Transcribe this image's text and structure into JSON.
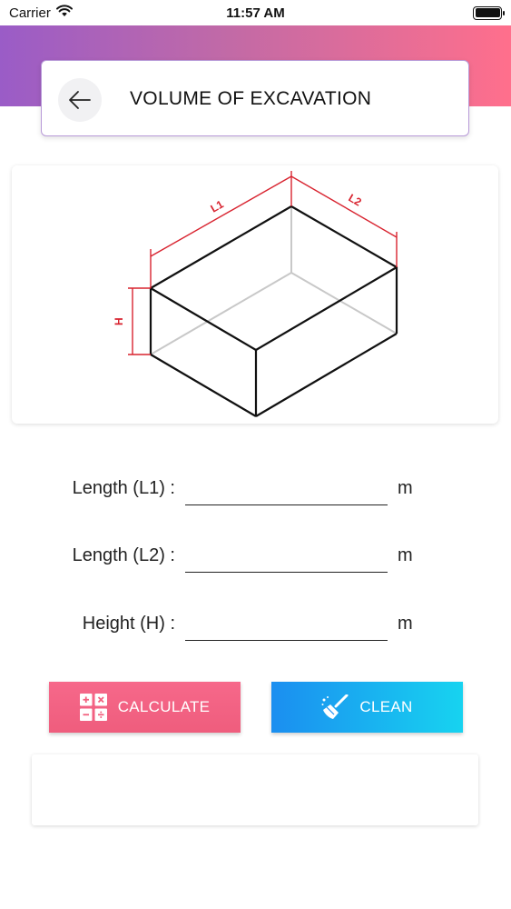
{
  "status_bar": {
    "carrier": "Carrier",
    "time": "11:57 AM"
  },
  "header": {
    "title": "VOLUME OF EXCAVATION",
    "back_icon": "arrow-left-icon"
  },
  "diagram": {
    "labels": {
      "l1": "L1",
      "l2": "L2",
      "h": "H"
    },
    "dimension_color": "#d8232f",
    "edge_color": "#111111",
    "hidden_edge_color": "#c8c8c8"
  },
  "form": {
    "fields": [
      {
        "label": "Length (L1) :",
        "value": "",
        "unit": "m"
      },
      {
        "label": "Length (L2) :",
        "value": "",
        "unit": "m"
      },
      {
        "label": "Height (H) :",
        "value": "",
        "unit": "m"
      }
    ]
  },
  "actions": {
    "calculate_label": "CALCULATE",
    "calculate_icon": "calculator-icon",
    "clean_label": "CLEAN",
    "clean_icon": "broom-icon"
  },
  "result": {
    "text": ""
  },
  "colors": {
    "gradient_start": "#9a5cc7",
    "gradient_end": "#ff6f8c",
    "calculate_bg": "#f2617f",
    "clean_bg_start": "#1b8ef0",
    "clean_bg_end": "#17d3f0"
  }
}
